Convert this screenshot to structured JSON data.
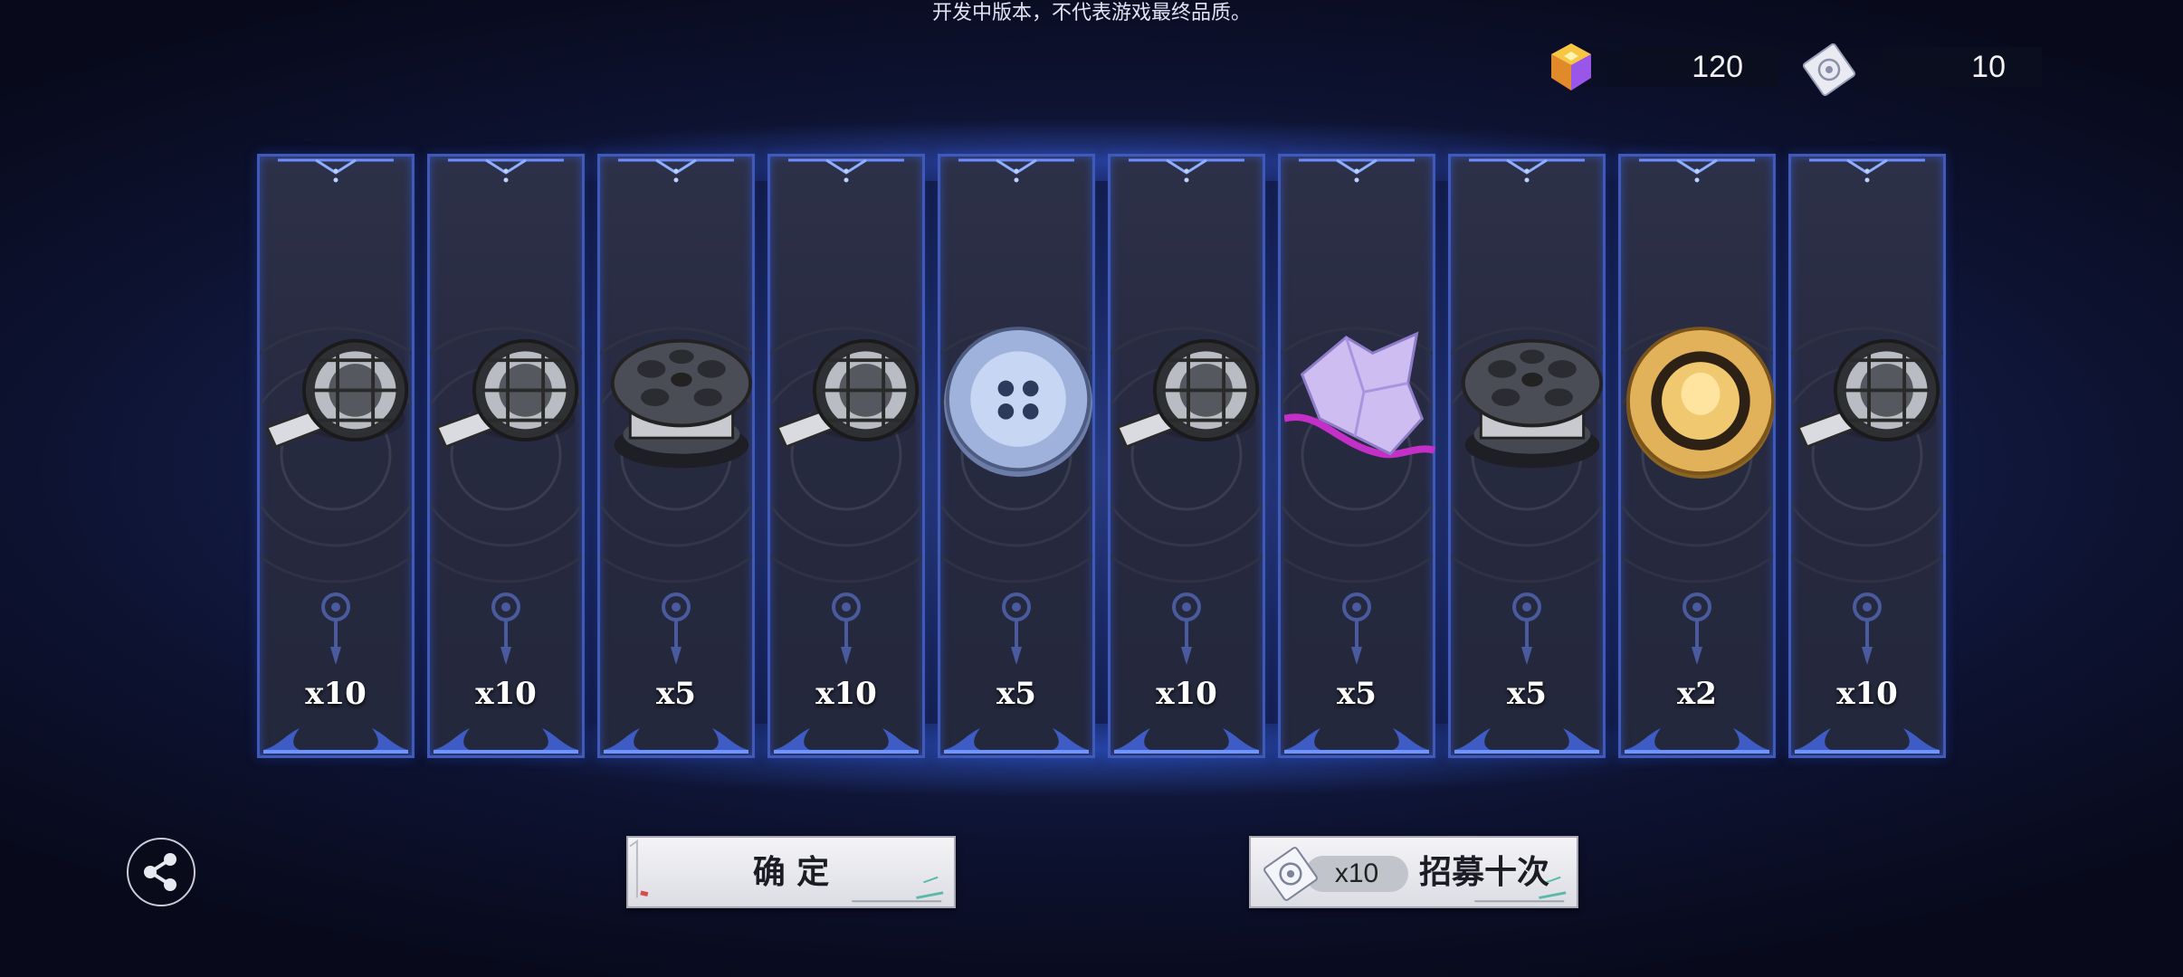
{
  "notice": "开发中版本，不代表游戏最终品质。",
  "currencies": {
    "gem": {
      "icon": "gem-icon",
      "value": "120"
    },
    "ticket": {
      "icon": "recruit-ticket-icon",
      "value": "10"
    }
  },
  "rewards": [
    {
      "item": "film-roll",
      "qty": "x10"
    },
    {
      "item": "film-roll",
      "qty": "x10"
    },
    {
      "item": "film-reel",
      "qty": "x5"
    },
    {
      "item": "film-roll",
      "qty": "x10"
    },
    {
      "item": "silver-button",
      "qty": "x5"
    },
    {
      "item": "film-roll",
      "qty": "x10"
    },
    {
      "item": "crystal-shard",
      "qty": "x5"
    },
    {
      "item": "film-reel",
      "qty": "x5"
    },
    {
      "item": "gold-coin",
      "qty": "x2"
    },
    {
      "item": "film-roll",
      "qty": "x10"
    }
  ],
  "buttons": {
    "confirm": "确 定",
    "recruit_ten": "招募十次",
    "recruit_cost": "x10"
  },
  "colors": {
    "card_border": "#3f5ab8",
    "background": "#0d1230",
    "accent_blue": "#4a7bff"
  }
}
